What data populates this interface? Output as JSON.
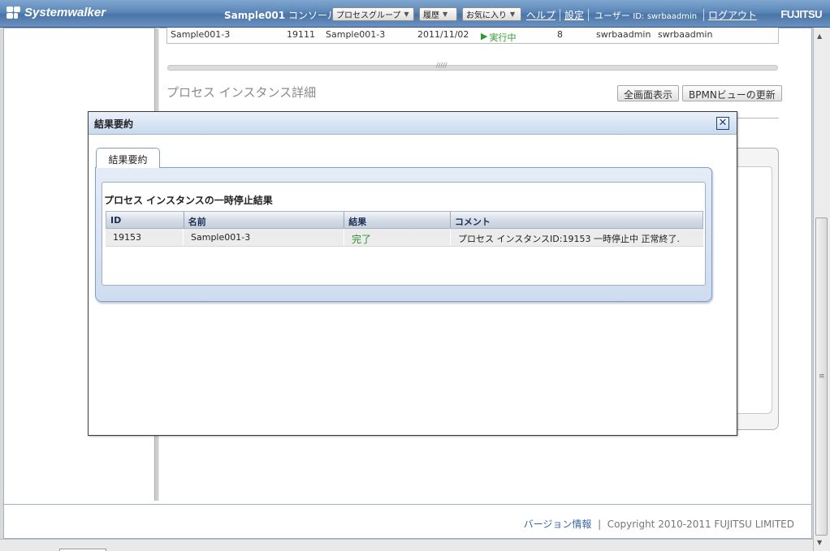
{
  "header": {
    "logo_text": "Systemwalker",
    "console_name": "Sample001",
    "console_suffix": "コンソール",
    "menus": [
      {
        "label": "プロセスグループ"
      },
      {
        "label": "履歴"
      },
      {
        "label": "お気に入り"
      }
    ],
    "help_label": "ヘルプ",
    "settings_label": "設定",
    "user_label": "ユーザー",
    "user_id_prefix": "ID:",
    "user_id": "swrbaadmin",
    "logout_label": "ログアウト",
    "brand": "FUJITSU"
  },
  "background": {
    "row": {
      "name": "Sample001-3",
      "id": "19111",
      "process": "Sample001-3",
      "date": "2011/11/02",
      "status": "実行中",
      "count": "8",
      "user1": "swrbaadmin",
      "user2": "swrbaadmin"
    },
    "section_heading": "プロセス インスタンス詳細",
    "fullscreen_button": "全画面表示",
    "refresh_button": "BPMNビューの更新"
  },
  "modal": {
    "title": "結果要約",
    "tab_label": "結果要約",
    "result_heading": "プロセス インスタンスの一時停止結果",
    "columns": [
      "ID",
      "名前",
      "結果",
      "コメント"
    ],
    "rows": [
      {
        "id": "19153",
        "name": "Sample001-3",
        "result": "完了",
        "comment": "プロセス インスタンスID:19153 一時停止中 正常終了."
      }
    ]
  },
  "footer": {
    "version_link": "バージョン情報",
    "separator": "|",
    "copyright": "Copyright 2010-2011 FUJITSU LIMITED"
  },
  "colors": {
    "header_blue": "#5b86b8",
    "status_green": "#2d9a2d",
    "link_blue": "#3766a8"
  }
}
